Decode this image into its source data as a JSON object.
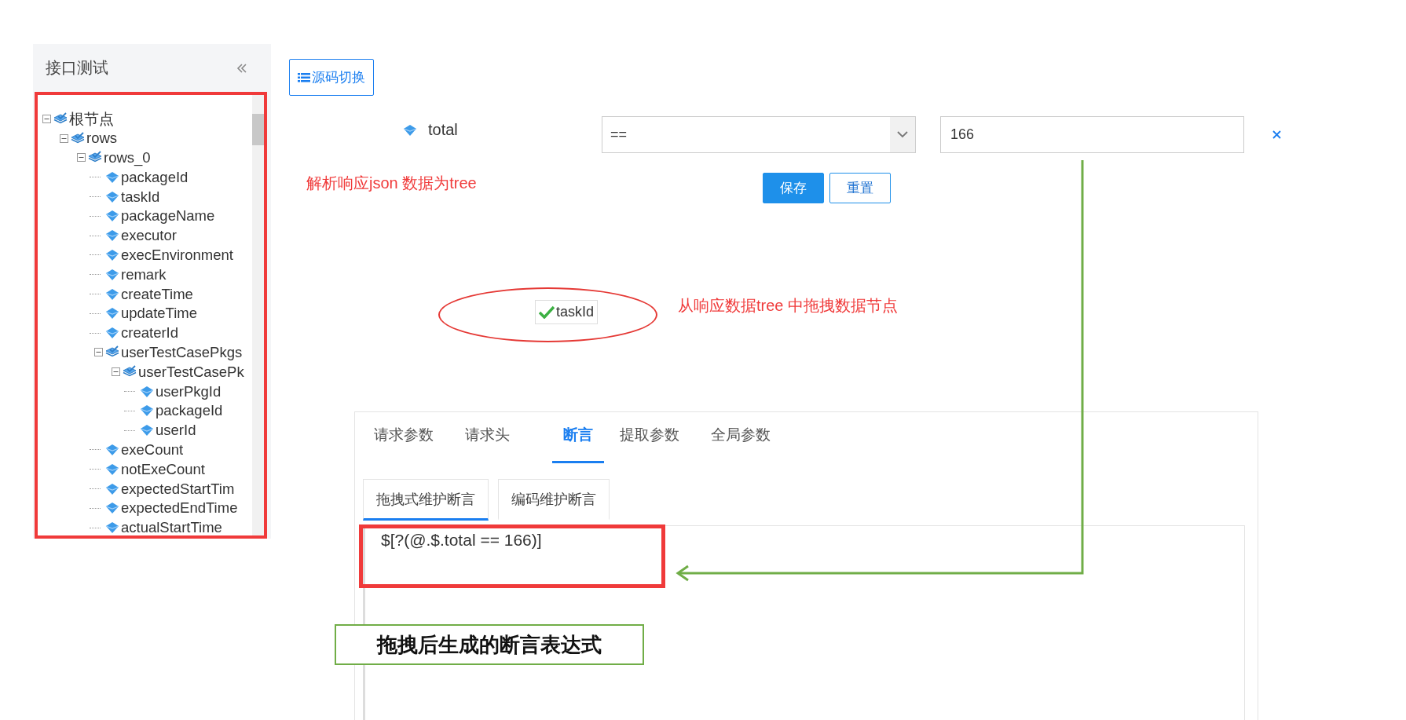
{
  "sidebar": {
    "title": "接口测试"
  },
  "tree": [
    {
      "label": "根节点",
      "expanded": true,
      "children": [
        {
          "label": "rows",
          "expanded": true,
          "children": [
            {
              "label": "rows_0",
              "expanded": true,
              "children": [
                {
                  "label": "packageId"
                },
                {
                  "label": "taskId"
                },
                {
                  "label": "packageName"
                },
                {
                  "label": "executor"
                },
                {
                  "label": "execEnvironment"
                },
                {
                  "label": "remark"
                },
                {
                  "label": "createTime"
                },
                {
                  "label": "updateTime"
                },
                {
                  "label": "createrId"
                },
                {
                  "label": "userTestCasePkgs",
                  "expanded": true,
                  "children": [
                    {
                      "label": "userTestCasePk",
                      "expanded": true,
                      "children": [
                        {
                          "label": "userPkgId"
                        },
                        {
                          "label": "packageId"
                        },
                        {
                          "label": "userId"
                        }
                      ]
                    }
                  ]
                },
                {
                  "label": "exeCount"
                },
                {
                  "label": "notExeCount"
                },
                {
                  "label": "expectedStartTim"
                },
                {
                  "label": "expectedEndTime"
                },
                {
                  "label": "actualStartTime"
                }
              ]
            }
          ]
        }
      ]
    }
  ],
  "toolbar": {
    "source_toggle": "源码切换"
  },
  "condition": {
    "field": "total",
    "operator": "==",
    "value": "166"
  },
  "form_buttons": [
    {
      "label": "保存",
      "kind": "primary"
    },
    {
      "label": "重置",
      "kind": "default"
    }
  ],
  "dragged_node": {
    "label": "taskId"
  },
  "tabs": [
    {
      "label": "请求参数",
      "selected": false
    },
    {
      "label": "请求头",
      "selected": false
    },
    {
      "label": "断言",
      "selected": true
    },
    {
      "label": "提取参数",
      "selected": false
    },
    {
      "label": "全局参数",
      "selected": false
    }
  ],
  "sub_tabs": [
    {
      "label": "拖拽式维护断言",
      "selected": true
    },
    {
      "label": "编码维护断言",
      "selected": false
    }
  ],
  "editor": {
    "value": "$[?(@.$.total == 166)]"
  },
  "annotations": {
    "parse_note": "解析响应json 数据为tree",
    "drag_note": "从响应数据tree 中拖拽数据节点",
    "result_note": "拖拽后生成的断言表达式"
  }
}
